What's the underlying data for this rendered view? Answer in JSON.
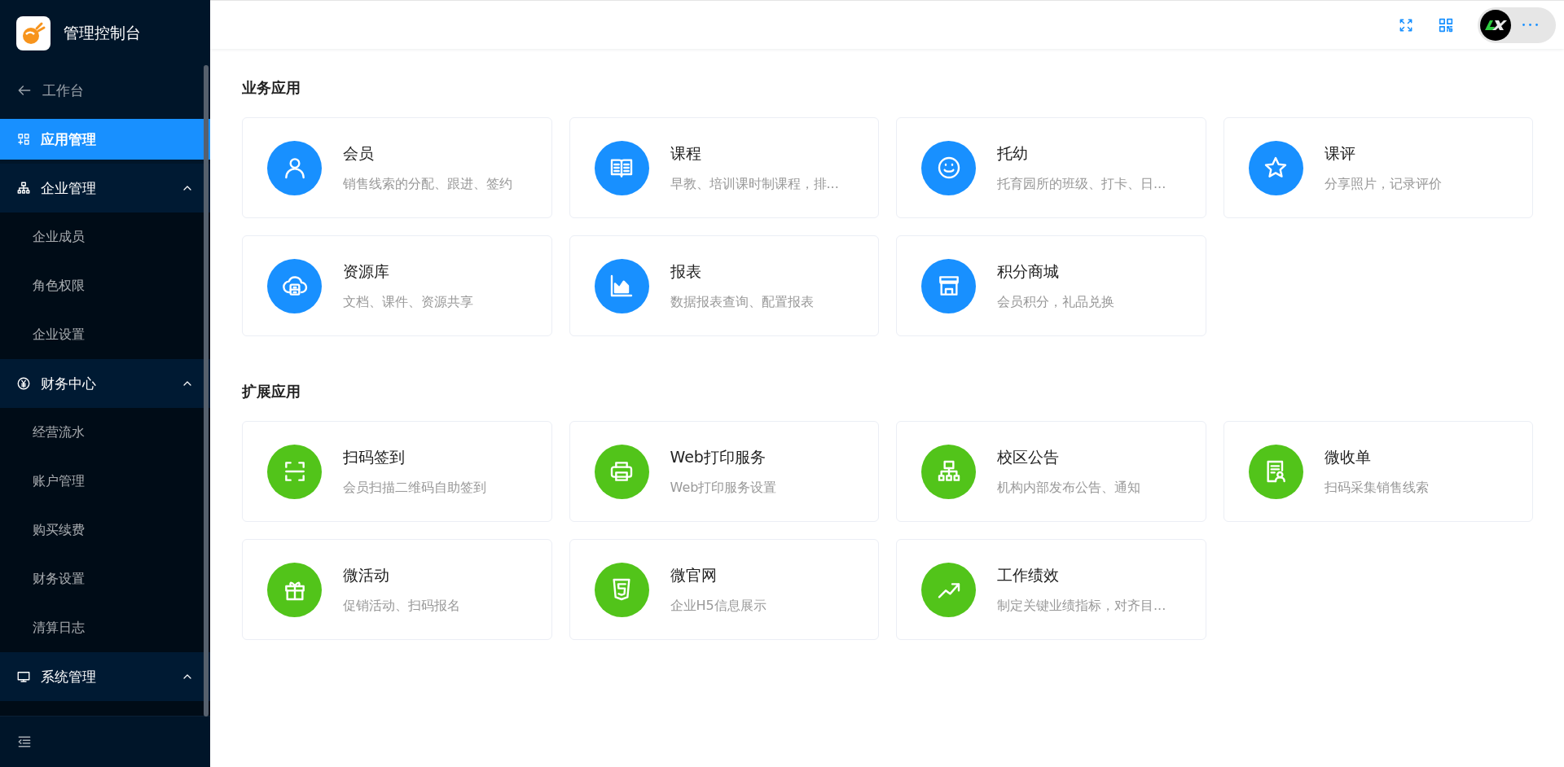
{
  "sidebar": {
    "brand": "管理控制台",
    "back": "工作台",
    "items": [
      {
        "kind": "item",
        "label": "应用管理",
        "selected": true
      },
      {
        "kind": "group",
        "label": "企业管理",
        "expanded": true,
        "children": [
          {
            "label": "企业成员",
            "selected": false
          },
          {
            "label": "角色权限",
            "selected": false
          },
          {
            "label": "企业设置",
            "selected": false
          }
        ]
      },
      {
        "kind": "group",
        "label": "财务中心",
        "expanded": true,
        "children": [
          {
            "label": "经营流水",
            "selected": false
          },
          {
            "label": "账户管理",
            "selected": false
          },
          {
            "label": "购买续费",
            "selected": false
          },
          {
            "label": "财务设置",
            "selected": false
          },
          {
            "label": "清算日志",
            "selected": false
          }
        ]
      },
      {
        "kind": "group",
        "label": "系统管理",
        "expanded": true
      }
    ]
  },
  "sections": [
    {
      "title": "业务应用",
      "color": "#1890ff",
      "apps": [
        {
          "name": "会员",
          "description": "销售线索的分配、跟进、签约"
        },
        {
          "name": "课程",
          "description": "早教、培训课时制课程，排..."
        },
        {
          "name": "托幼",
          "description": "托育园所的班级、打卡、日..."
        },
        {
          "name": "课评",
          "description": "分享照片，记录评价"
        },
        {
          "name": "资源库",
          "description": "文档、课件、资源共享"
        },
        {
          "name": "报表",
          "description": "数据报表查询、配置报表"
        },
        {
          "name": "积分商城",
          "description": "会员积分，礼品兑换"
        }
      ]
    },
    {
      "title": "扩展应用",
      "color": "#52c41a",
      "apps": [
        {
          "name": "扫码签到",
          "description": "会员扫描二维码自助签到"
        },
        {
          "name": "Web打印服务",
          "description": "Web打印服务设置"
        },
        {
          "name": "校区公告",
          "description": "机构内部发布公告、通知"
        },
        {
          "name": "微收单",
          "description": "扫码采集销售线索"
        },
        {
          "name": "微活动",
          "description": "促销活动、扫码报名"
        },
        {
          "name": "微官网",
          "description": "企业H5信息展示"
        },
        {
          "name": "工作绩效",
          "description": "制定关键业绩指标，对齐目..."
        }
      ]
    }
  ]
}
